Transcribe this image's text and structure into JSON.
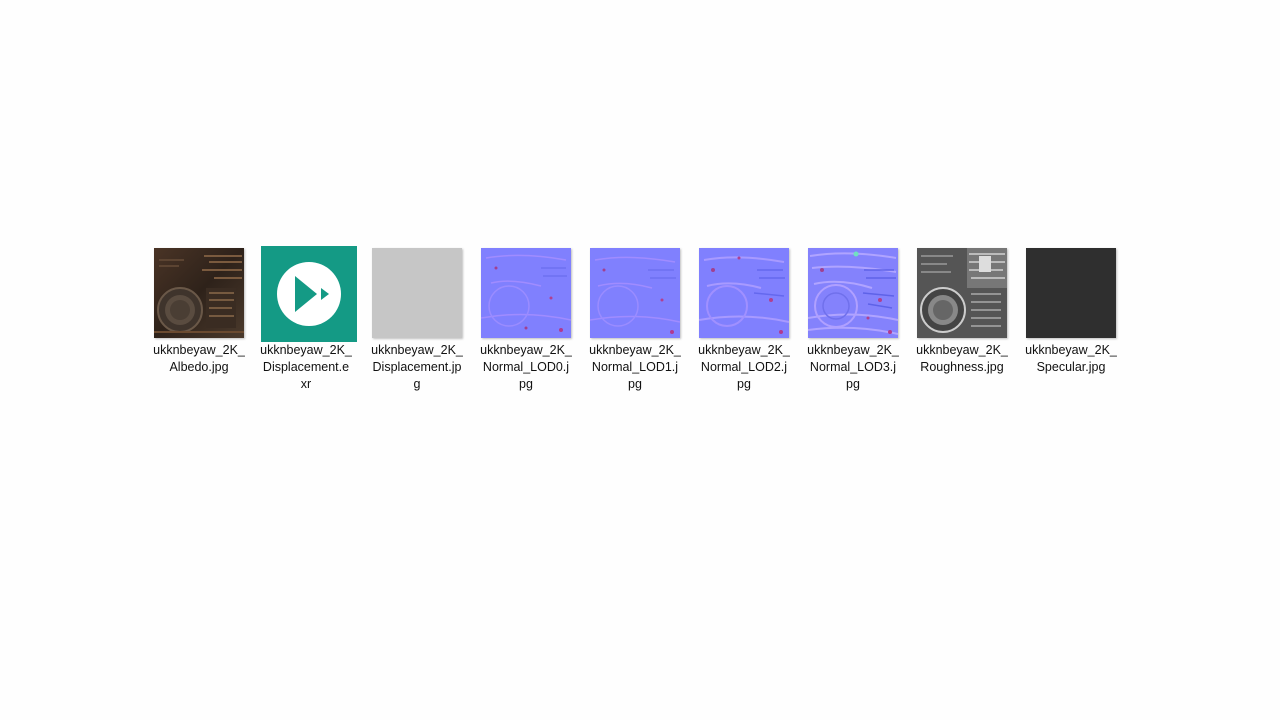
{
  "files": [
    {
      "name": "ukknbeyaw_2K_\nAlbedo.jpg",
      "kind": "albedo",
      "icon": "image-thumbnail-icon"
    },
    {
      "name": "ukknbeyaw_2K_\nDisplacement.e\nxr",
      "kind": "exr",
      "icon": "media-player-icon"
    },
    {
      "name": "ukknbeyaw_2K_\nDisplacement.jp\ng",
      "kind": "displacement",
      "icon": "image-thumbnail-icon"
    },
    {
      "name": "ukknbeyaw_2K_\nNormal_LOD0.j\npg",
      "kind": "normal",
      "icon": "image-thumbnail-icon"
    },
    {
      "name": "ukknbeyaw_2K_\nNormal_LOD1.j\npg",
      "kind": "normal",
      "icon": "image-thumbnail-icon"
    },
    {
      "name": "ukknbeyaw_2K_\nNormal_LOD2.j\npg",
      "kind": "normal",
      "icon": "image-thumbnail-icon"
    },
    {
      "name": "ukknbeyaw_2K_\nNormal_LOD3.j\npg",
      "kind": "normal-noisy",
      "icon": "image-thumbnail-icon"
    },
    {
      "name": "ukknbeyaw_2K_\nRoughness.jpg",
      "kind": "roughness",
      "icon": "image-thumbnail-icon"
    },
    {
      "name": "ukknbeyaw_2K_\nSpecular.jpg",
      "kind": "specular",
      "icon": "image-thumbnail-icon"
    }
  ],
  "colors": {
    "background": "#fefefe",
    "exr_tile": "#149a85",
    "normal_base": "#8080fe",
    "displacement_gray": "#c6c6c6",
    "specular_dark": "#2f2f2f",
    "albedo_dark": "#3a2a1e"
  }
}
